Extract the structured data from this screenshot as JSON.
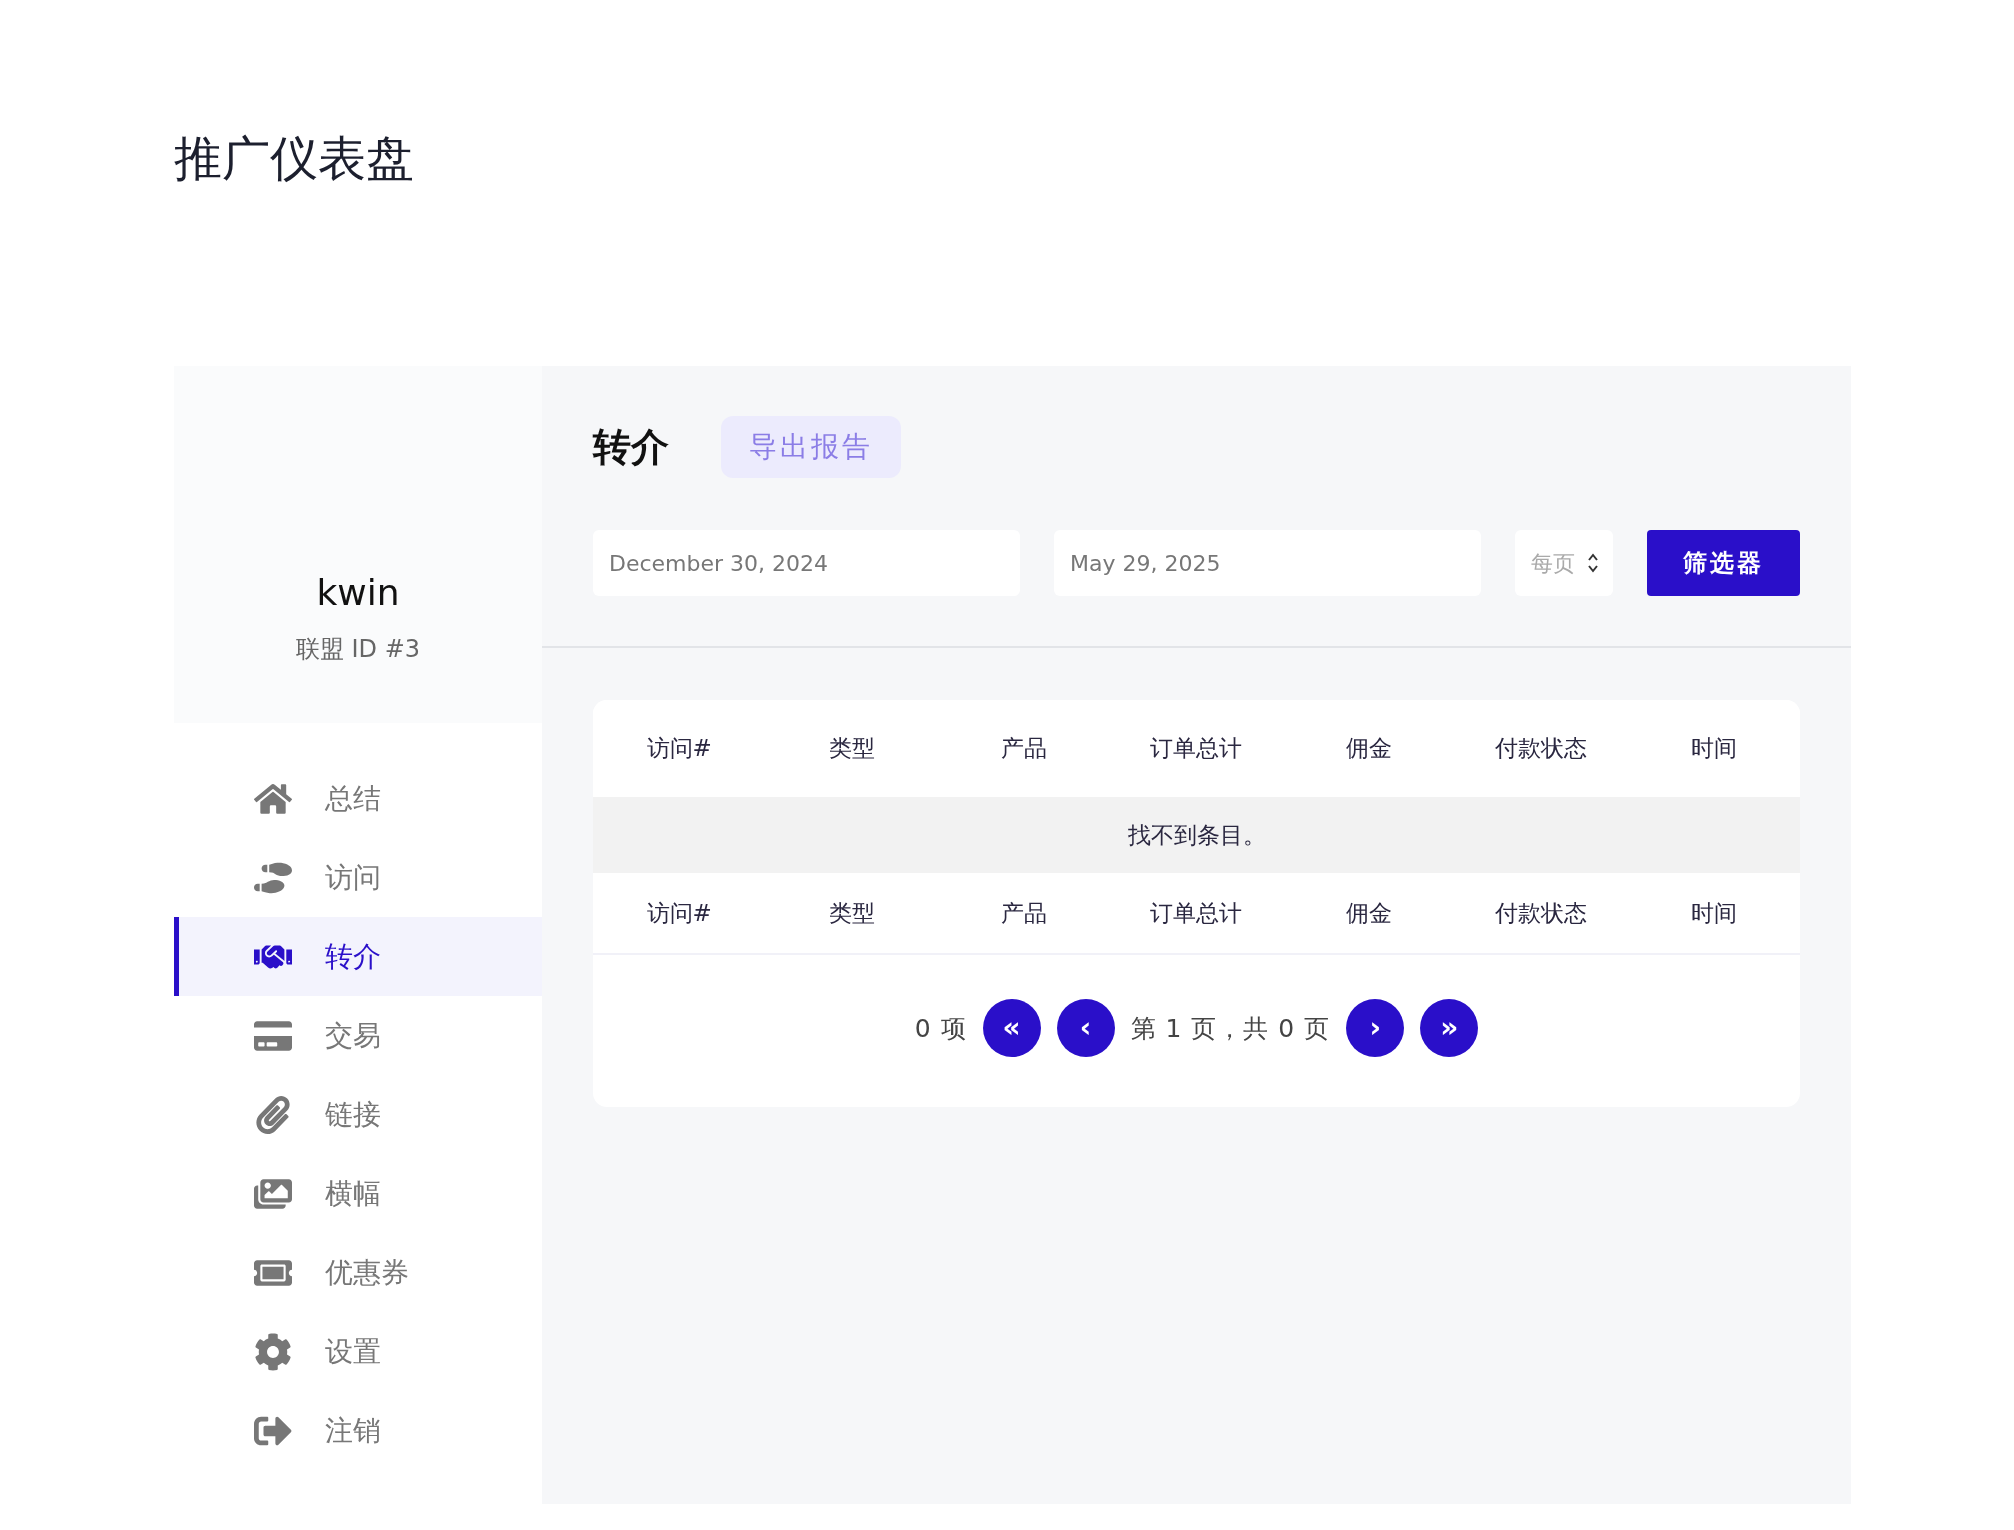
{
  "page_title": "推广仪表盘",
  "profile": {
    "name": "kwin",
    "affiliate_id": "联盟 ID #3"
  },
  "sidebar": {
    "items": [
      {
        "label": "总结",
        "selected": false
      },
      {
        "label": "访问",
        "selected": false
      },
      {
        "label": "转介",
        "selected": true
      },
      {
        "label": "交易",
        "selected": false
      },
      {
        "label": "链接",
        "selected": false
      },
      {
        "label": "横幅",
        "selected": false
      },
      {
        "label": "优惠券",
        "selected": false
      },
      {
        "label": "设置",
        "selected": false
      },
      {
        "label": "注销",
        "selected": false
      }
    ]
  },
  "header": {
    "title": "转介",
    "export_button": "导出报告"
  },
  "filters": {
    "start_date": "December 30, 2024",
    "end_date": "May 29, 2025",
    "per_page": {
      "placeholder": "每页"
    },
    "filter_button": "筛选器"
  },
  "table": {
    "columns": [
      "访问#",
      "类型",
      "产品",
      "订单总计",
      "佣金",
      "付款状态",
      "时间"
    ],
    "empty_message": "找不到条目。",
    "footer_columns": [
      "访问#",
      "类型",
      "产品",
      "订单总计",
      "佣金",
      "付款状态",
      "时间"
    ]
  },
  "pagination": {
    "count": "0 项",
    "first": "«",
    "prev": "‹",
    "page_info": "第 1 页，共 0 页",
    "next": "›",
    "last": "»"
  }
}
